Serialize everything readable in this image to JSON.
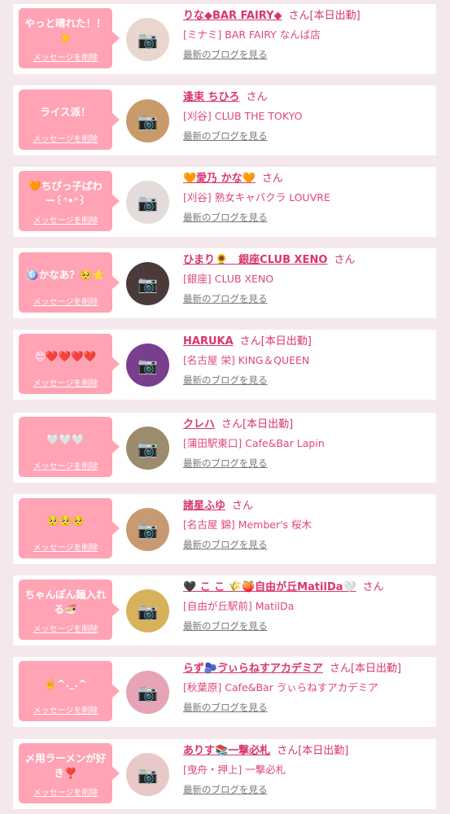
{
  "cards": [
    {
      "message": "やっと晴れた！！☀️",
      "delete_label": "メッセージを削除",
      "name": "りな◆BAR FAIRY◆",
      "san": "さん",
      "status": "[本日出勤]",
      "shop": "[ミナミ] BAR FAIRY なんば店",
      "blog_label": "最新のブログを見る",
      "avatar_icon": "📷",
      "avatar_color": "#e8d6cf"
    },
    {
      "message": "ライス派！",
      "delete_label": "メッセージを削除",
      "name": "逢束 ちひろ",
      "san": "さん",
      "status": "",
      "shop": "[刈谷] CLUB THE TOKYO",
      "blog_label": "最新のブログを見る",
      "avatar_icon": "📷",
      "avatar_color": "#c99a6a"
    },
    {
      "message": "🧡ちぴっ子ぱわー꒰ᐢ•ᐢ꒱",
      "delete_label": "メッセージを削除",
      "name": "🧡愛乃 かな🧡",
      "san": "さん",
      "status": "",
      "shop": "[刈谷] 熟女キャバクラ LOUVRE",
      "blog_label": "最新のブログを見る",
      "avatar_icon": "📷",
      "avatar_color": "#e3dcda"
    },
    {
      "message": "🪩かなあ？🥺⭐️",
      "delete_label": "メッセージを削除",
      "name": "ひまり🌻　銀座CLUB XENO",
      "san": "さん",
      "status": "",
      "shop": "[銀座] CLUB XENO",
      "blog_label": "最新のブログを見る",
      "avatar_icon": "📷",
      "avatar_color": "#4a3b3a"
    },
    {
      "message": "😍❤️❤️❤️❤️",
      "delete_label": "メッセージを削除",
      "name": "HARUKA",
      "san": "さん",
      "status": "[本日出勤]",
      "shop": "[名古屋 栄] KING＆QUEEN",
      "blog_label": "最新のブログを見る",
      "avatar_icon": "📷",
      "avatar_color": "#7a3e8e"
    },
    {
      "message": "🤍🤍🤍",
      "delete_label": "メッセージを削除",
      "name": "クレハ",
      "san": "さん",
      "status": "[本日出勤]",
      "shop": "[蒲田駅東口] Cafe&Bar Lapin",
      "blog_label": "最新のブログを見る",
      "avatar_icon": "📷",
      "avatar_color": "#9a8c6c"
    },
    {
      "message": "🥺🥺🥺",
      "delete_label": "メッセージを削除",
      "name": "諸星ふゆ",
      "san": "さん",
      "status": "",
      "shop": "[名古屋 錦] Member's 桜木",
      "blog_label": "最新のブログを見る",
      "avatar_icon": "📷",
      "avatar_color": "#c89a72"
    },
    {
      "message": "ちゃんぽん麺入れる🍜",
      "delete_label": "メッセージを削除",
      "name": "🖤 こ こ 🌾🍑自由が丘MatilDa🤍",
      "san": "さん",
      "status": "",
      "shop": "[自由が丘駅前] MatilDa",
      "blog_label": "最新のブログを見る",
      "avatar_icon": "📷",
      "avatar_color": "#d8b25a"
    },
    {
      "message": "☝️^._.^",
      "delete_label": "メッセージを削除",
      "name": "らず🫐ゔぃらねすアカデミア",
      "san": "さん",
      "status": "[本日出勤]",
      "shop": "[秋葉原] Cafe&Bar ゔぃらねすアカデミア",
      "blog_label": "最新のブログを見る",
      "avatar_icon": "📷",
      "avatar_color": "#e7a4b6"
    },
    {
      "message": "〆用ラーメンが好き❣️",
      "delete_label": "メッセージを削除",
      "name": "ありす📚一撃必札",
      "san": "さん",
      "status": "[本日出勤]",
      "shop": "[曳舟・押上] 一撃必札",
      "blog_label": "最新のブログを見る",
      "avatar_icon": "📷",
      "avatar_color": "#e9c9c8"
    }
  ]
}
